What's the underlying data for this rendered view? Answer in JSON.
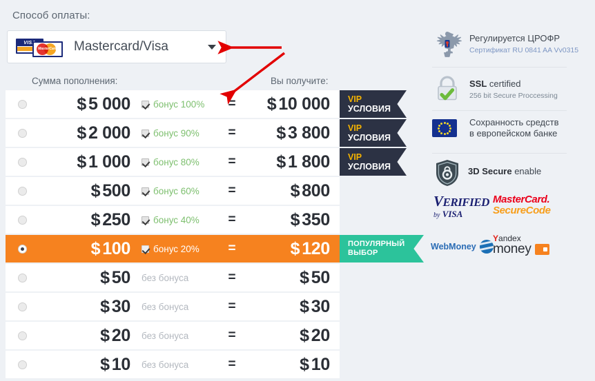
{
  "payment": {
    "label": "Способ оплаты:",
    "selected_method": "Mastercard/Visa",
    "caret_icon": "chevron-down-icon",
    "visa_text": "VISA",
    "mastercard_text": "MasterCard"
  },
  "table": {
    "header_amount": "Сумма пополнения:",
    "header_receive": "Вы получите:",
    "currency": "$",
    "equals": "=",
    "rows": [
      {
        "amount": "5 000",
        "bonus": "бонус 100%",
        "has_bonus": true,
        "total": "10 000",
        "badge": "vip",
        "badge_l1": "VIP",
        "badge_l2": "УСЛОВИЯ",
        "selected": false
      },
      {
        "amount": "2 000",
        "bonus": "бонус 90%",
        "has_bonus": true,
        "total": "3 800",
        "badge": "vip",
        "badge_l1": "VIP",
        "badge_l2": "УСЛОВИЯ",
        "selected": false
      },
      {
        "amount": "1 000",
        "bonus": "бонус 80%",
        "has_bonus": true,
        "total": "1 800",
        "badge": "vip",
        "badge_l1": "VIP",
        "badge_l2": "УСЛОВИЯ",
        "selected": false
      },
      {
        "amount": "500",
        "bonus": "бонус 60%",
        "has_bonus": true,
        "total": "800",
        "badge": "none",
        "badge_l1": "",
        "badge_l2": "",
        "selected": false
      },
      {
        "amount": "250",
        "bonus": "бонус 40%",
        "has_bonus": true,
        "total": "350",
        "badge": "none",
        "badge_l1": "",
        "badge_l2": "",
        "selected": false
      },
      {
        "amount": "100",
        "bonus": "бонус 20%",
        "has_bonus": true,
        "total": "120",
        "badge": "popular",
        "badge_l1": "ПОПУЛЯРНЫЙ",
        "badge_l2": "ВЫБОР",
        "selected": true
      },
      {
        "amount": "50",
        "bonus": "без бонуса",
        "has_bonus": false,
        "total": "50",
        "badge": "none",
        "badge_l1": "",
        "badge_l2": "",
        "selected": false
      },
      {
        "amount": "30",
        "bonus": "без бонуса",
        "has_bonus": false,
        "total": "30",
        "badge": "none",
        "badge_l1": "",
        "badge_l2": "",
        "selected": false
      },
      {
        "amount": "20",
        "bonus": "без бонуса",
        "has_bonus": false,
        "total": "20",
        "badge": "none",
        "badge_l1": "",
        "badge_l2": "",
        "selected": false
      },
      {
        "amount": "10",
        "bonus": "без бонуса",
        "has_bonus": false,
        "total": "10",
        "badge": "none",
        "badge_l1": "",
        "badge_l2": "",
        "selected": false
      }
    ]
  },
  "trust": {
    "regulator": {
      "icon": "double-headed-eagle-crest-icon",
      "title": "Регулируется ЦРОФР",
      "subtitle": "Сертификат RU 0841 AA Vv0315"
    },
    "ssl": {
      "icon": "padlock-check-icon",
      "title_bold": "SSL",
      "title_rest": " certified",
      "subtitle": "256 bit Secure Proccessing"
    },
    "bank": {
      "icon": "eu-flag-icon",
      "line1": "Сохранность средств",
      "line2": "в европейском банке"
    },
    "secure3d": {
      "icon": "shield-lock-icon",
      "title_bold": "3D Secure",
      "title_rest": " enable"
    },
    "logos": {
      "verified_by_visa": {
        "v": "V",
        "erified": "ERIFIED",
        "by": "by",
        "visa": "VISA"
      },
      "mastercard_securecode": {
        "l1": "MasterCard.",
        "l2": "SecureCode"
      },
      "webmoney": {
        "text": "WebMoney",
        "icon": "webmoney-globe-icon"
      },
      "yandex_money": {
        "l1_y": "Y",
        "l1_rest": "andex",
        "l2": "money",
        "icon": "wallet-icon"
      }
    }
  },
  "colors": {
    "page_bg": "#eef1f5",
    "accent_orange": "#f6821f",
    "vip_navy": "#2c3244",
    "vip_gold": "#f5b301",
    "popular_green": "#2cc39b",
    "bonus_green": "#7dbf6e",
    "annotation_red": "#e20000"
  },
  "annotations": {
    "arrow_to_dropdown": "red-arrow-left-icon",
    "arrow_to_bonus_column": "red-arrow-diagonal-icon"
  }
}
